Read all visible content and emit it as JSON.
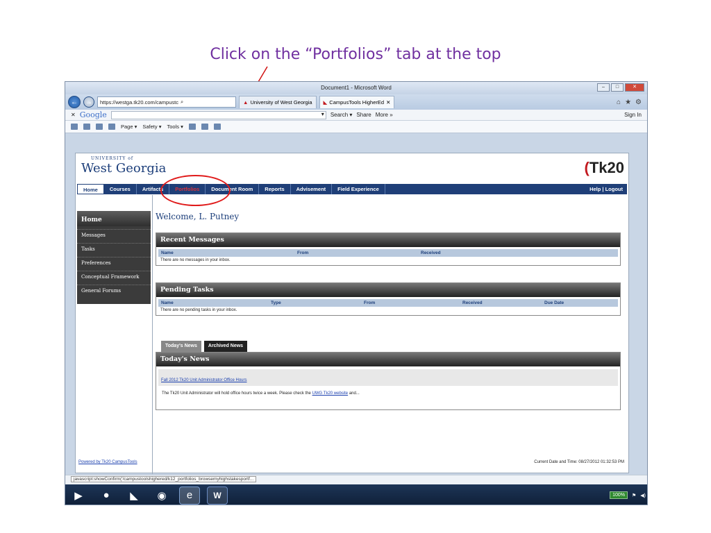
{
  "caption": "Click on the “Portfolios” tab at the top",
  "window_title": "Document1 - Microsoft Word",
  "browser": {
    "address": "https://westga.tk20.com/campustc",
    "tabs": [
      "University of West Georgia",
      "CampusTools HigherEd"
    ],
    "google_label": "Google",
    "search_label": "Search ▾",
    "share_label": "Share",
    "more_label": "More »",
    "signin_label": "Sign In",
    "cmd": {
      "page": "Page ▾",
      "safety": "Safety ▾",
      "tools": "Tools ▾"
    }
  },
  "header": {
    "uni_small": "UNIVERSITY of",
    "uni_big": "West Georgia",
    "tk_logo": "Tk20"
  },
  "nav": {
    "items": [
      "Home",
      "Courses",
      "Artifacts",
      "Portfolios",
      "Document Room",
      "Reports",
      "Advisement",
      "Field Experience"
    ],
    "help": "Help | Logout"
  },
  "sidebar": {
    "title": "Home",
    "items": [
      "Messages",
      "Tasks",
      "Preferences",
      "Conceptual Framework",
      "General Forums"
    ]
  },
  "welcome": "Welcome, L. Putney",
  "messages": {
    "title": "Recent Messages",
    "columns": [
      "Name",
      "From",
      "Received"
    ],
    "empty": "There are no messages in your inbox."
  },
  "tasks": {
    "title": "Pending Tasks",
    "columns": [
      "Name",
      "Type",
      "From",
      "Received",
      "Due Date"
    ],
    "empty": "There are no pending tasks in your inbox."
  },
  "news": {
    "tab_today": "Today's News",
    "tab_archived": "Archived News",
    "title": "Today's News",
    "headline": "Fall 2012 Tk20 Unit Administrator Office Hours",
    "body_pre": "The Tk20 Unit Administrator will hold office hours twice a week. Please check the",
    "body_link": "UWG Tk20 website",
    "body_post": "and..."
  },
  "footer": {
    "powered": "Powered by Tk20 CampusTools",
    "datetime": "Current Date and Time: 08/27/2012 01:32:53 PM"
  },
  "status_text": "javascript:showConfirm('/campustoolshighered/k12_portfolios_browsemyhighstakesportf...",
  "taskbar": {
    "battery": "100%"
  },
  "colors": {
    "caption": "#7030a0",
    "nav": "#1f3f78",
    "highlight": "#e01b1b"
  }
}
